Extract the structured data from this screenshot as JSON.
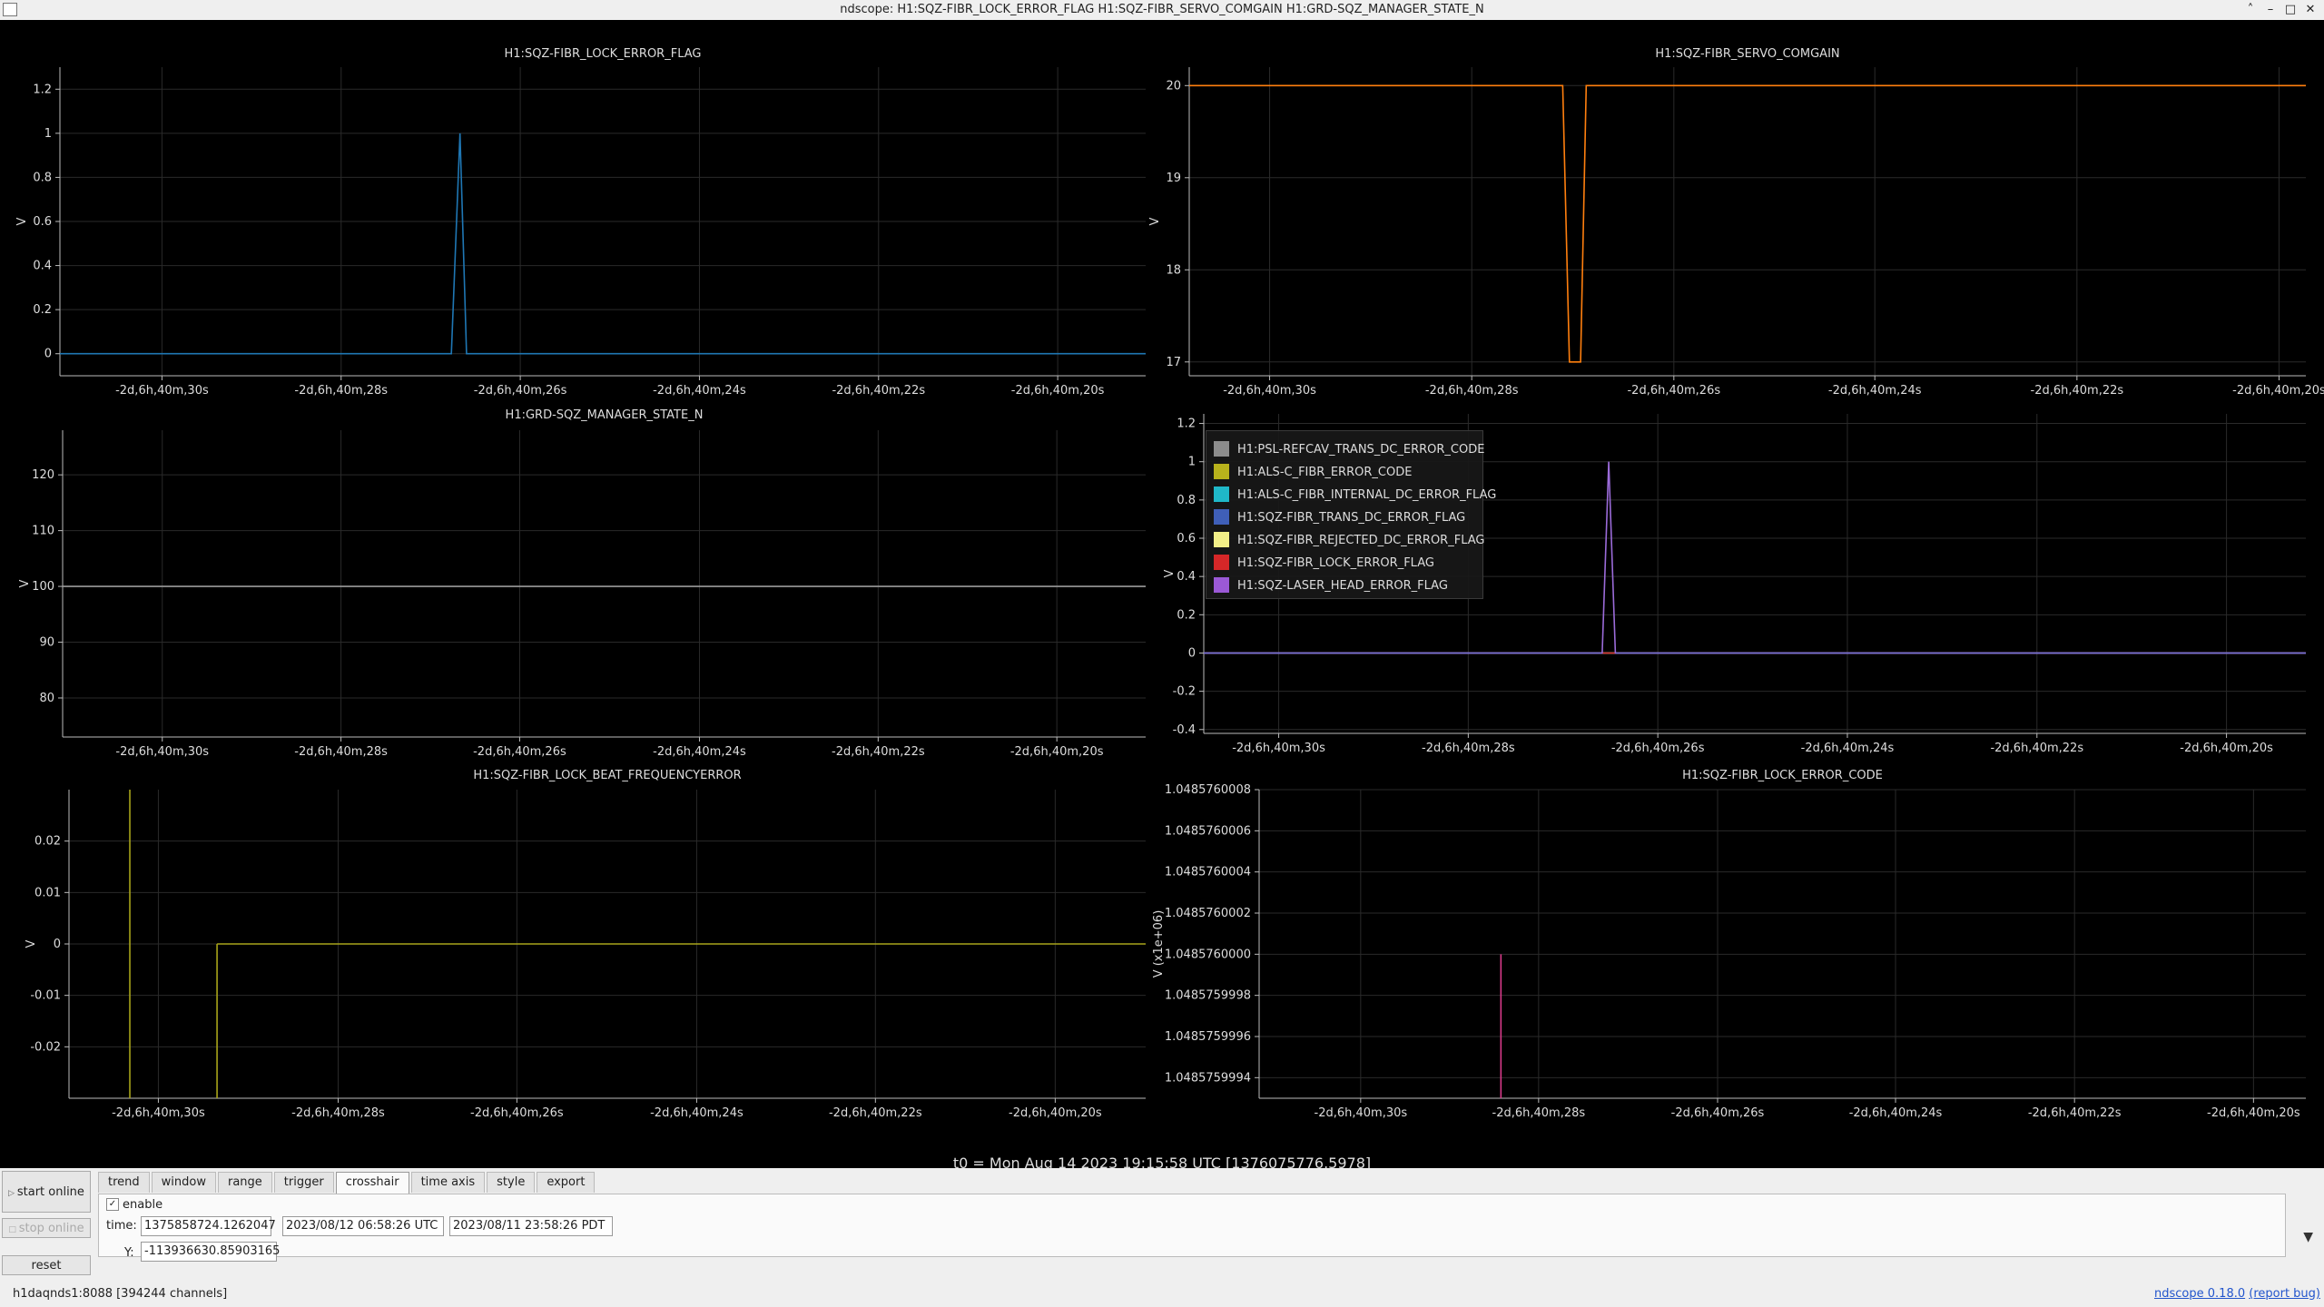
{
  "window": {
    "title": "ndscope: H1:SQZ-FIBR_LOCK_ERROR_FLAG H1:SQZ-FIBR_SERVO_COMGAIN H1:GRD-SQZ_MANAGER_STATE_N",
    "controls": [
      "˄",
      "–",
      "□",
      "✕"
    ]
  },
  "colors": {
    "background": "#000000",
    "grid": "#2a2a2a",
    "axis": "#bbbbbb",
    "blue_trace": "#1f77b4",
    "orange_trace": "#ff7f0e",
    "olive_trace": "#a8a41a",
    "purple_trace": "#9b6bd9",
    "pink_trace": "#d93a8a",
    "gray_trace": "#9a9a9a"
  },
  "plots": [
    {
      "name": "plot-lock-error-flag",
      "title": "H1:SQZ-FIBR_LOCK_ERROR_FLAG",
      "ylabel": "V",
      "ylim": [
        -0.1,
        1.3
      ],
      "yticks": [
        "0",
        "0.2",
        "0.4",
        "0.6",
        "0.8",
        "1",
        "1.2"
      ],
      "xticks": [
        "-2d,6h,40m,30s",
        "-2d,6h,40m,28s",
        "-2d,6h,40m,26s",
        "-2d,6h,40m,24s",
        "-2d,6h,40m,22s",
        "-2d,6h,40m,20s"
      ]
    },
    {
      "name": "plot-servo-comgain",
      "title": "H1:SQZ-FIBR_SERVO_COMGAIN",
      "ylabel": "V",
      "ylim": [
        16.85,
        20.2
      ],
      "yticks": [
        "17",
        "18",
        "19",
        "20"
      ],
      "xticks": [
        "-2d,6h,40m,30s",
        "-2d,6h,40m,28s",
        "-2d,6h,40m,26s",
        "-2d,6h,40m,24s",
        "-2d,6h,40m,22s",
        "-2d,6h,40m,20s"
      ]
    },
    {
      "name": "plot-manager-state",
      "title": "H1:GRD-SQZ_MANAGER_STATE_N",
      "ylabel": "V",
      "ylim": [
        73,
        128
      ],
      "yticks": [
        "80",
        "90",
        "100",
        "110",
        "120"
      ],
      "xticks": [
        "-2d,6h,40m,30s",
        "-2d,6h,40m,28s",
        "-2d,6h,40m,26s",
        "-2d,6h,40m,24s",
        "-2d,6h,40m,22s",
        "-2d,6h,40m,20s"
      ]
    },
    {
      "name": "plot-error-flags",
      "title": "",
      "ylabel": "V",
      "ylim": [
        -0.42,
        1.25
      ],
      "yticks": [
        "-0.4",
        "-0.2",
        "0",
        "0.2",
        "0.4",
        "0.6",
        "0.8",
        "1",
        "1.2"
      ],
      "xticks": [
        "-2d,6h,40m,30s",
        "-2d,6h,40m,28s",
        "-2d,6h,40m,26s",
        "-2d,6h,40m,24s",
        "-2d,6h,40m,22s",
        "-2d,6h,40m,20s"
      ]
    },
    {
      "name": "plot-beat-frequency-error",
      "title": "H1:SQZ-FIBR_LOCK_BEAT_FREQUENCYERROR",
      "ylabel": "V",
      "ylim": [
        -0.03,
        0.03
      ],
      "yticks": [
        "-0.02",
        "-0.01",
        "0",
        "0.01",
        "0.02"
      ],
      "xticks": [
        "-2d,6h,40m,30s",
        "-2d,6h,40m,28s",
        "-2d,6h,40m,26s",
        "-2d,6h,40m,24s",
        "-2d,6h,40m,22s",
        "-2d,6h,40m,20s"
      ]
    },
    {
      "name": "plot-lock-error-code",
      "title": "H1:SQZ-FIBR_LOCK_ERROR_CODE",
      "ylabel": "V (x1e+06)",
      "ylim": [
        1.0485759993,
        1.0485760008
      ],
      "yticks": [
        "1.0485759994",
        "1.0485759996",
        "1.0485759998",
        "1.0485760000",
        "1.0485760002",
        "1.0485760004",
        "1.0485760006",
        "1.0485760008"
      ],
      "xticks": [
        "-2d,6h,40m,30s",
        "-2d,6h,40m,28s",
        "-2d,6h,40m,26s",
        "-2d,6h,40m,24s",
        "-2d,6h,40m,22s",
        "-2d,6h,40m,20s"
      ]
    }
  ],
  "legend": {
    "items": [
      {
        "label": "H1:PSL-REFCAV_TRANS_DC_ERROR_CODE",
        "color": "#8c8c8c"
      },
      {
        "label": "H1:ALS-C_FIBR_ERROR_CODE",
        "color": "#b8b21c"
      },
      {
        "label": "H1:ALS-C_FIBR_INTERNAL_DC_ERROR_FLAG",
        "color": "#1fb8c8"
      },
      {
        "label": "H1:SQZ-FIBR_TRANS_DC_ERROR_FLAG",
        "color": "#3f5fb8"
      },
      {
        "label": "H1:SQZ-FIBR_REJECTED_DC_ERROR_FLAG",
        "color": "#f2ef88"
      },
      {
        "label": "H1:SQZ-FIBR_LOCK_ERROR_FLAG",
        "color": "#d62728"
      },
      {
        "label": "H1:SQZ-LASER_HEAD_ERROR_FLAG",
        "color": "#9b59d6"
      }
    ]
  },
  "chart_data": [
    {
      "type": "line",
      "title": "H1:SQZ-FIBR_LOCK_ERROR_FLAG",
      "ylabel": "V",
      "ylim": [
        -0.1,
        1.3
      ],
      "x_ticks": [
        "-2d,6h,40m,30s",
        "-2d,6h,40m,28s",
        "-2d,6h,40m,26s",
        "-2d,6h,40m,24s",
        "-2d,6h,40m,22s",
        "-2d,6h,40m,20s"
      ],
      "series": [
        {
          "values": [
            0,
            0,
            1,
            0,
            0
          ]
        }
      ]
    },
    {
      "type": "line",
      "title": "H1:SQZ-FIBR_SERVO_COMGAIN",
      "ylabel": "V",
      "ylim": [
        16.85,
        20.2
      ],
      "x_ticks": [
        "-2d,6h,40m,30s",
        "-2d,6h,40m,28s",
        "-2d,6h,40m,26s",
        "-2d,6h,40m,24s",
        "-2d,6h,40m,22s",
        "-2d,6h,40m,20s"
      ],
      "series": [
        {
          "values": [
            20,
            20,
            17,
            17,
            20,
            20
          ]
        }
      ]
    },
    {
      "type": "line",
      "title": "H1:GRD-SQZ_MANAGER_STATE_N",
      "ylabel": "V",
      "ylim": [
        73,
        128
      ],
      "x_ticks": [
        "-2d,6h,40m,30s",
        "-2d,6h,40m,28s",
        "-2d,6h,40m,26s",
        "-2d,6h,40m,24s",
        "-2d,6h,40m,22s",
        "-2d,6h,40m,20s"
      ],
      "series": [
        {
          "values": [
            100,
            100
          ]
        }
      ]
    },
    {
      "type": "line",
      "ylabel": "V",
      "ylim": [
        -0.42,
        1.25
      ],
      "x_ticks": [
        "-2d,6h,40m,30s",
        "-2d,6h,40m,28s",
        "-2d,6h,40m,26s",
        "-2d,6h,40m,24s",
        "-2d,6h,40m,22s",
        "-2d,6h,40m,20s"
      ],
      "series": [
        {
          "name": "H1:PSL-REFCAV_TRANS_DC_ERROR_CODE",
          "values": [
            0,
            0
          ]
        },
        {
          "name": "H1:ALS-C_FIBR_ERROR_CODE",
          "values": [
            0,
            0
          ]
        },
        {
          "name": "H1:ALS-C_FIBR_INTERNAL_DC_ERROR_FLAG",
          "values": [
            0,
            0
          ]
        },
        {
          "name": "H1:SQZ-FIBR_TRANS_DC_ERROR_FLAG",
          "values": [
            0,
            0
          ]
        },
        {
          "name": "H1:SQZ-FIBR_REJECTED_DC_ERROR_FLAG",
          "values": [
            0,
            0
          ]
        },
        {
          "name": "H1:SQZ-FIBR_LOCK_ERROR_FLAG",
          "values": [
            0,
            0
          ]
        },
        {
          "name": "H1:SQZ-LASER_HEAD_ERROR_FLAG",
          "values": [
            0,
            0,
            1,
            0,
            0
          ]
        }
      ]
    },
    {
      "type": "line",
      "title": "H1:SQZ-FIBR_LOCK_BEAT_FREQUENCYERROR",
      "ylabel": "V",
      "ylim": [
        -0.03,
        0.03
      ],
      "x_ticks": [
        "-2d,6h,40m,30s",
        "-2d,6h,40m,28s",
        "-2d,6h,40m,26s",
        "-2d,6h,40m,24s",
        "-2d,6h,40m,22s",
        "-2d,6h,40m,20s"
      ],
      "series": [
        {
          "values": [
            0,
            0
          ]
        }
      ]
    },
    {
      "type": "line",
      "title": "H1:SQZ-FIBR_LOCK_ERROR_CODE",
      "ylabel": "V (x1e+06)",
      "ylim": [
        1.0485759993,
        1.0485760008
      ],
      "x_ticks": [
        "-2d,6h,40m,30s",
        "-2d,6h,40m,28s",
        "-2d,6h,40m,26s",
        "-2d,6h,40m,24s",
        "-2d,6h,40m,22s",
        "-2d,6h,40m,20s"
      ],
      "series": [
        {
          "values": [
            1.0485759993,
            1.048576
          ]
        }
      ]
    }
  ],
  "t0_label": "t0 = Mon Aug 14 2023 19:15:58 UTC [1376075776.5978]",
  "sidebar": {
    "start_online": "start online",
    "stop_online": "stop online",
    "reset": "reset"
  },
  "tabs": [
    "trend",
    "window",
    "range",
    "trigger",
    "crosshair",
    "time axis",
    "style",
    "export"
  ],
  "active_tab": "crosshair",
  "crosshair": {
    "enable_label": "enable",
    "enable_check": "✓",
    "time_label": "time:",
    "gps_value": "1375858724.1262047",
    "utc_value": "2023/08/12 06:58:26 UTC",
    "pdt_value": "2023/08/11 23:58:26 PDT",
    "y_label": "Y:",
    "y_value": "-113936630.85903165",
    "expand_icon": "▼"
  },
  "status": {
    "server": "h1daqnds1:8088  [394244 channels]",
    "version_link": "ndscope 0.18.0",
    "report_link": "(report bug)"
  }
}
